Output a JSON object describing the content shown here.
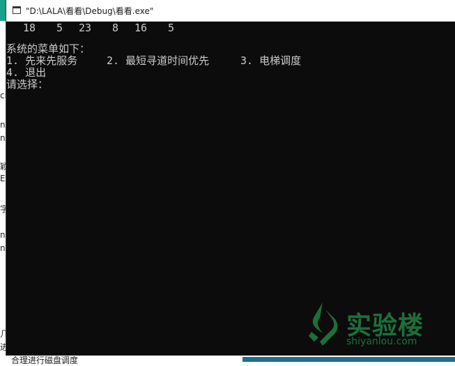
{
  "background": {
    "left_fragments": [
      "ci",
      "n",
      "n",
      "颖",
      "Eí",
      "字",
      "n",
      "n",
      "几",
      "进"
    ],
    "bottom_text": "合理进行磁盘调度"
  },
  "window": {
    "title": "\"D:\\LALA\\看看\\Debug\\看看.exe\"",
    "icon": "console-app-icon"
  },
  "console": {
    "numbers": [
      "18",
      "5",
      "23",
      "8",
      "16",
      "5"
    ],
    "menu_header": "系统的菜单如下：",
    "menu_row1": [
      "1. 先来先服务",
      "2. 最短寻道时间优先",
      "3. 电梯调度"
    ],
    "menu_row2": "4. 退出",
    "prompt": "请选择："
  },
  "watermark": {
    "title": "实验楼",
    "subtitle": "shiyanlou.com",
    "color": "#1e6e3a"
  },
  "colors": {
    "console_bg": "#0c0c0c",
    "console_text": "#cccccc",
    "titlebar_bg": "#ffffff"
  }
}
